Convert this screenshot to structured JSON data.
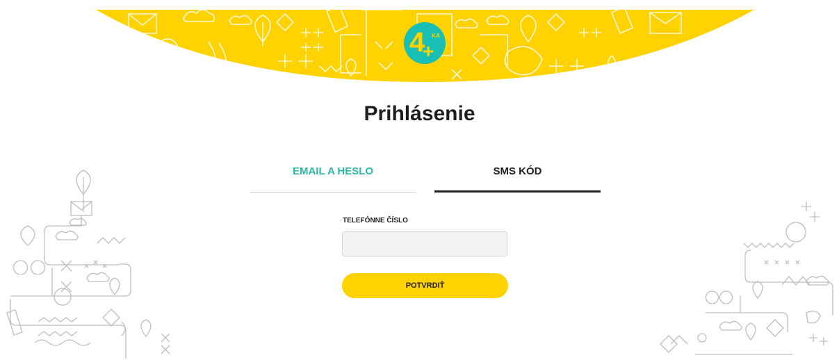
{
  "brand": {
    "logo_main": "4",
    "logo_sup": "KA",
    "yellow": "#ffd200",
    "teal": "#17bfb5"
  },
  "page": {
    "title": "Prihlásenie"
  },
  "tabs": [
    {
      "label": "EMAIL A HESLO",
      "active": false
    },
    {
      "label": "SMS KÓD",
      "active": true
    }
  ],
  "form": {
    "phone_label": "TELEFÓNNE ČÍSLO",
    "phone_value": "",
    "phone_placeholder": "",
    "submit_label": "POTVRDIŤ"
  }
}
